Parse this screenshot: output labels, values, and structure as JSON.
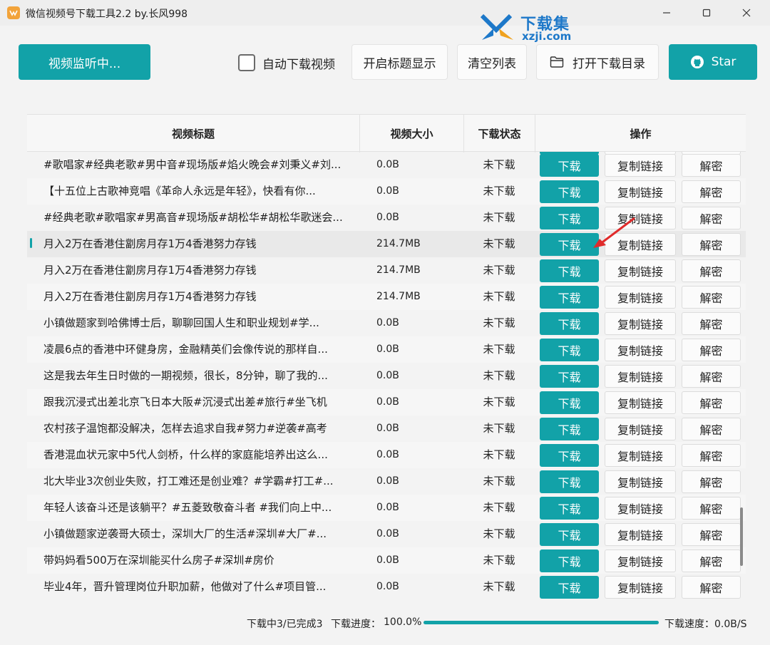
{
  "window": {
    "title": "微信视频号下载工具2.2 by.长风998",
    "min_icon": "minimize-icon",
    "max_icon": "maximize-icon",
    "close_icon": "close-icon"
  },
  "watermark": {
    "big": "下载集",
    "small": "xzji.com"
  },
  "toolbar": {
    "monitor_label": "视频监听中...",
    "auto_download_label": "自动下载视频",
    "auto_download_checked": false,
    "show_title_label": "开启标题显示",
    "clear_list_label": "清空列表",
    "open_dir_label": "打开下载目录",
    "star_label": "Star",
    "accent_color": "#12a2a8"
  },
  "table": {
    "headers": {
      "title": "视频标题",
      "size": "视频大小",
      "status": "下载状态",
      "ops": "操作"
    },
    "actions": {
      "download": "下载",
      "copy": "复制链接",
      "decrypt": "解密"
    },
    "rows": [
      {
        "title": "#歌唱家#经典老歌#男中音#现场版#焰火晚会#刘秉义#刘...",
        "size": "0.0B",
        "status": "未下载"
      },
      {
        "title": "【十五位上古歌神竞唱《革命人永远是年轻》，快看有你...",
        "size": "0.0B",
        "status": "未下载"
      },
      {
        "title": "#经典老歌#歌唱家#男高音#现场版#胡松华#胡松华歌迷会...",
        "size": "0.0B",
        "status": "未下载"
      },
      {
        "title": "月入2万在香港住劏房月存1万4香港努力存钱",
        "size": "214.7MB",
        "status": "未下载",
        "highlighted": true
      },
      {
        "title": "月入2万在香港住劏房月存1万4香港努力存钱",
        "size": "214.7MB",
        "status": "未下载"
      },
      {
        "title": "月入2万在香港住劏房月存1万4香港努力存钱",
        "size": "214.7MB",
        "status": "未下载"
      },
      {
        "title": "小镇做题家到哈佛博士后，聊聊回国人生和职业规划#学...",
        "size": "0.0B",
        "status": "未下载"
      },
      {
        "title": "凌晨6点的香港中环健身房，金融精英们会像传说的那样自...",
        "size": "0.0B",
        "status": "未下载"
      },
      {
        "title": "这是我去年生日时做的一期视频，很长，8分钟，聊了我的...",
        "size": "0.0B",
        "status": "未下载"
      },
      {
        "title": "跟我沉浸式出差北京飞日本大阪#沉浸式出差#旅行#坐飞机",
        "size": "0.0B",
        "status": "未下载"
      },
      {
        "title": "农村孩子温饱都没解决，怎样去追求自我#努力#逆袭#高考",
        "size": "0.0B",
        "status": "未下载"
      },
      {
        "title": "香港混血状元家中5代人剑桥，什么样的家庭能培养出这么...",
        "size": "0.0B",
        "status": "未下载"
      },
      {
        "title": "北大毕业3次创业失败，打工难还是创业难？#学霸#打工#...",
        "size": "0.0B",
        "status": "未下载"
      },
      {
        "title": "年轻人该奋斗还是该躺平？#五菱致敬奋斗者 #我们向上中...",
        "size": "0.0B",
        "status": "未下载"
      },
      {
        "title": "小镇做题家逆袭哥大硕士，深圳大厂的生活#深圳#大厂#...",
        "size": "0.0B",
        "status": "未下载"
      },
      {
        "title": "带妈妈看500万在深圳能买什么房子#深圳#房价",
        "size": "0.0B",
        "status": "未下载"
      },
      {
        "title": "毕业4年，晋升管理岗位升职加薪，他做对了什么#项目管...",
        "size": "0.0B",
        "status": "未下载"
      }
    ]
  },
  "status": {
    "count_text": "下载中3/已完成3",
    "progress_label": "下载进度：",
    "progress_value": "100.0%",
    "progress_fraction": 1.0,
    "speed_text": "下载速度：0.0B/S"
  }
}
